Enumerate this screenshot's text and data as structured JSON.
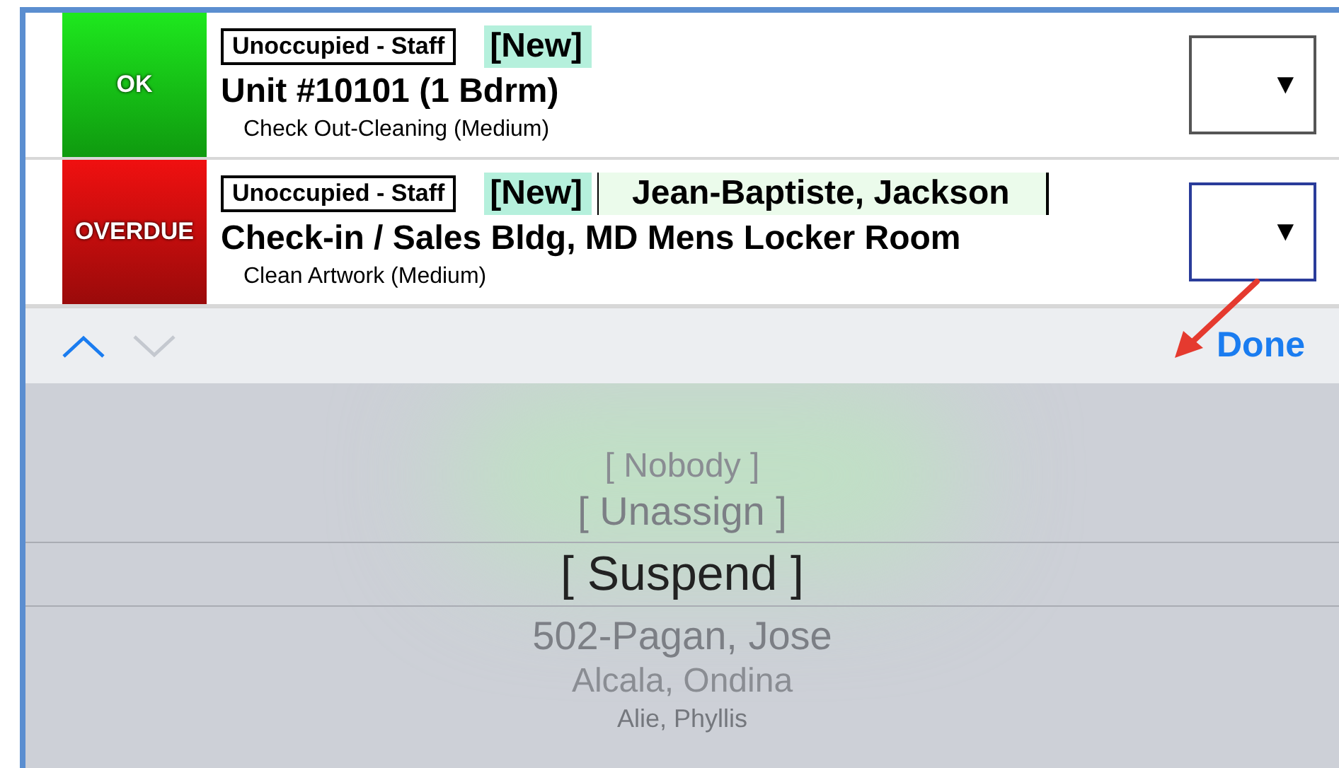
{
  "tasks": [
    {
      "status": {
        "label": "OK",
        "kind": "ok"
      },
      "tag": "Unoccupied - Staff",
      "new_badge": "[New]",
      "title": "Unit #10101 (1 Bdrm)",
      "subtitle": "Check Out-Cleaning (Medium)",
      "dropdown": {
        "focused": false,
        "caret": "▼"
      }
    },
    {
      "status": {
        "label": "OVERDUE",
        "kind": "overdue"
      },
      "tag": "Unoccupied - Staff",
      "new_badge": "[New]",
      "assignee": "Jean-Baptiste, Jackson",
      "title": "Check-in / Sales Bldg, MD Mens Locker Room",
      "subtitle": "Clean Artwork (Medium)",
      "dropdown": {
        "focused": true,
        "caret": "▼"
      }
    }
  ],
  "toolbar": {
    "nav": [
      {
        "kind": "up",
        "disabled": false
      },
      {
        "kind": "down",
        "disabled": true
      }
    ],
    "done": "Done"
  },
  "picker": [
    {
      "label": "[ Nobody ]",
      "selected": false
    },
    {
      "label": "[ Unassign ]",
      "selected": false
    },
    {
      "label": "[ Suspend ]",
      "selected": true
    },
    {
      "label": "502-Pagan, Jose",
      "selected": false
    },
    {
      "label": "Alcala, Ondina",
      "selected": false
    },
    {
      "label": "Alie, Phyllis",
      "selected": false
    }
  ]
}
